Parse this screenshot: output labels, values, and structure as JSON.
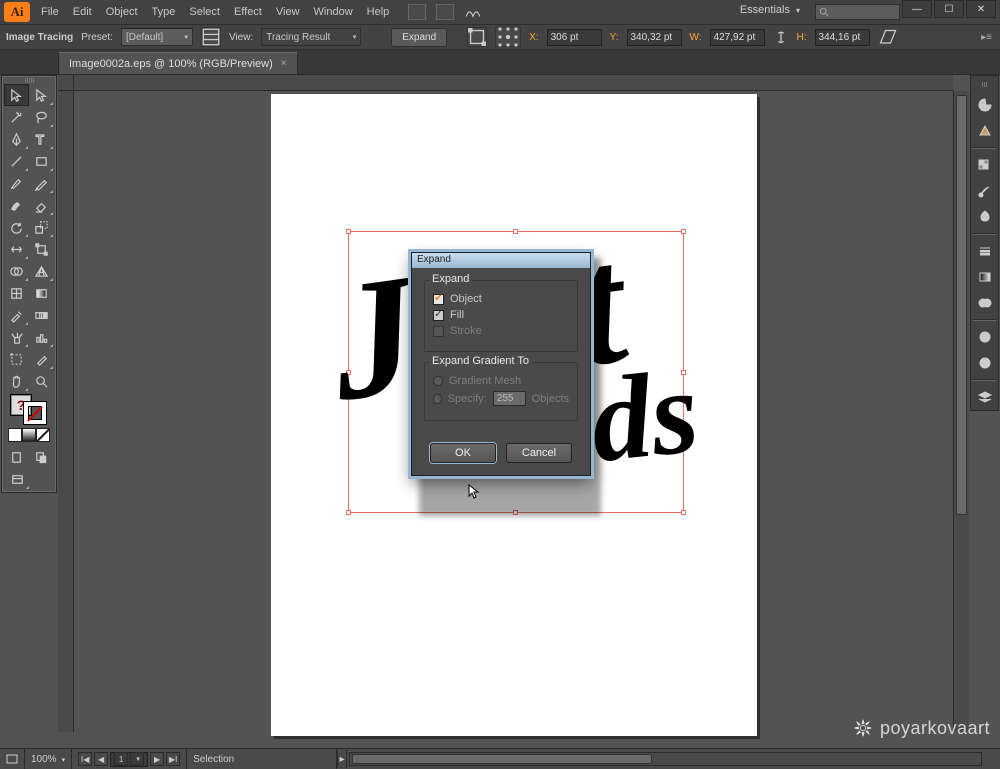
{
  "app": {
    "logo_text": "Ai"
  },
  "menu": {
    "items": [
      "File",
      "Edit",
      "Object",
      "Type",
      "Select",
      "Effect",
      "View",
      "Window",
      "Help"
    ]
  },
  "workspace": {
    "label": "Essentials"
  },
  "win": {
    "min": "—",
    "max": "☐",
    "close": "✕"
  },
  "control": {
    "mode": "Image Tracing",
    "preset_label": "Preset:",
    "preset_value": "[Default]",
    "view_label": "View:",
    "view_value": "Tracing Result",
    "expand_btn": "Expand",
    "x_label": "X:",
    "x_value": "306 pt",
    "y_label": "Y:",
    "y_value": "340,32 pt",
    "w_label": "W:",
    "w_value": "427,92 pt",
    "h_label": "H:",
    "h_value": "344,16 pt"
  },
  "doc": {
    "tab_title": "Image0002a.eps @ 100% (RGB/Preview)",
    "tab_close": "×"
  },
  "dialog": {
    "title": "Expand",
    "group1": "Expand",
    "object": "Object",
    "fill": "Fill",
    "stroke": "Stroke",
    "group2": "Expand Gradient To",
    "grad_mesh": "Gradient Mesh",
    "specify": "Specify:",
    "specify_value": "255",
    "specify_unit": "Objects",
    "ok": "OK",
    "cancel": "Cancel"
  },
  "status": {
    "zoom": "100%",
    "artboard_num": "1",
    "tool": "Selection"
  },
  "watermark": {
    "text": "poyarkovaart"
  },
  "art": {
    "line1": "Just",
    "line2": "ds"
  }
}
